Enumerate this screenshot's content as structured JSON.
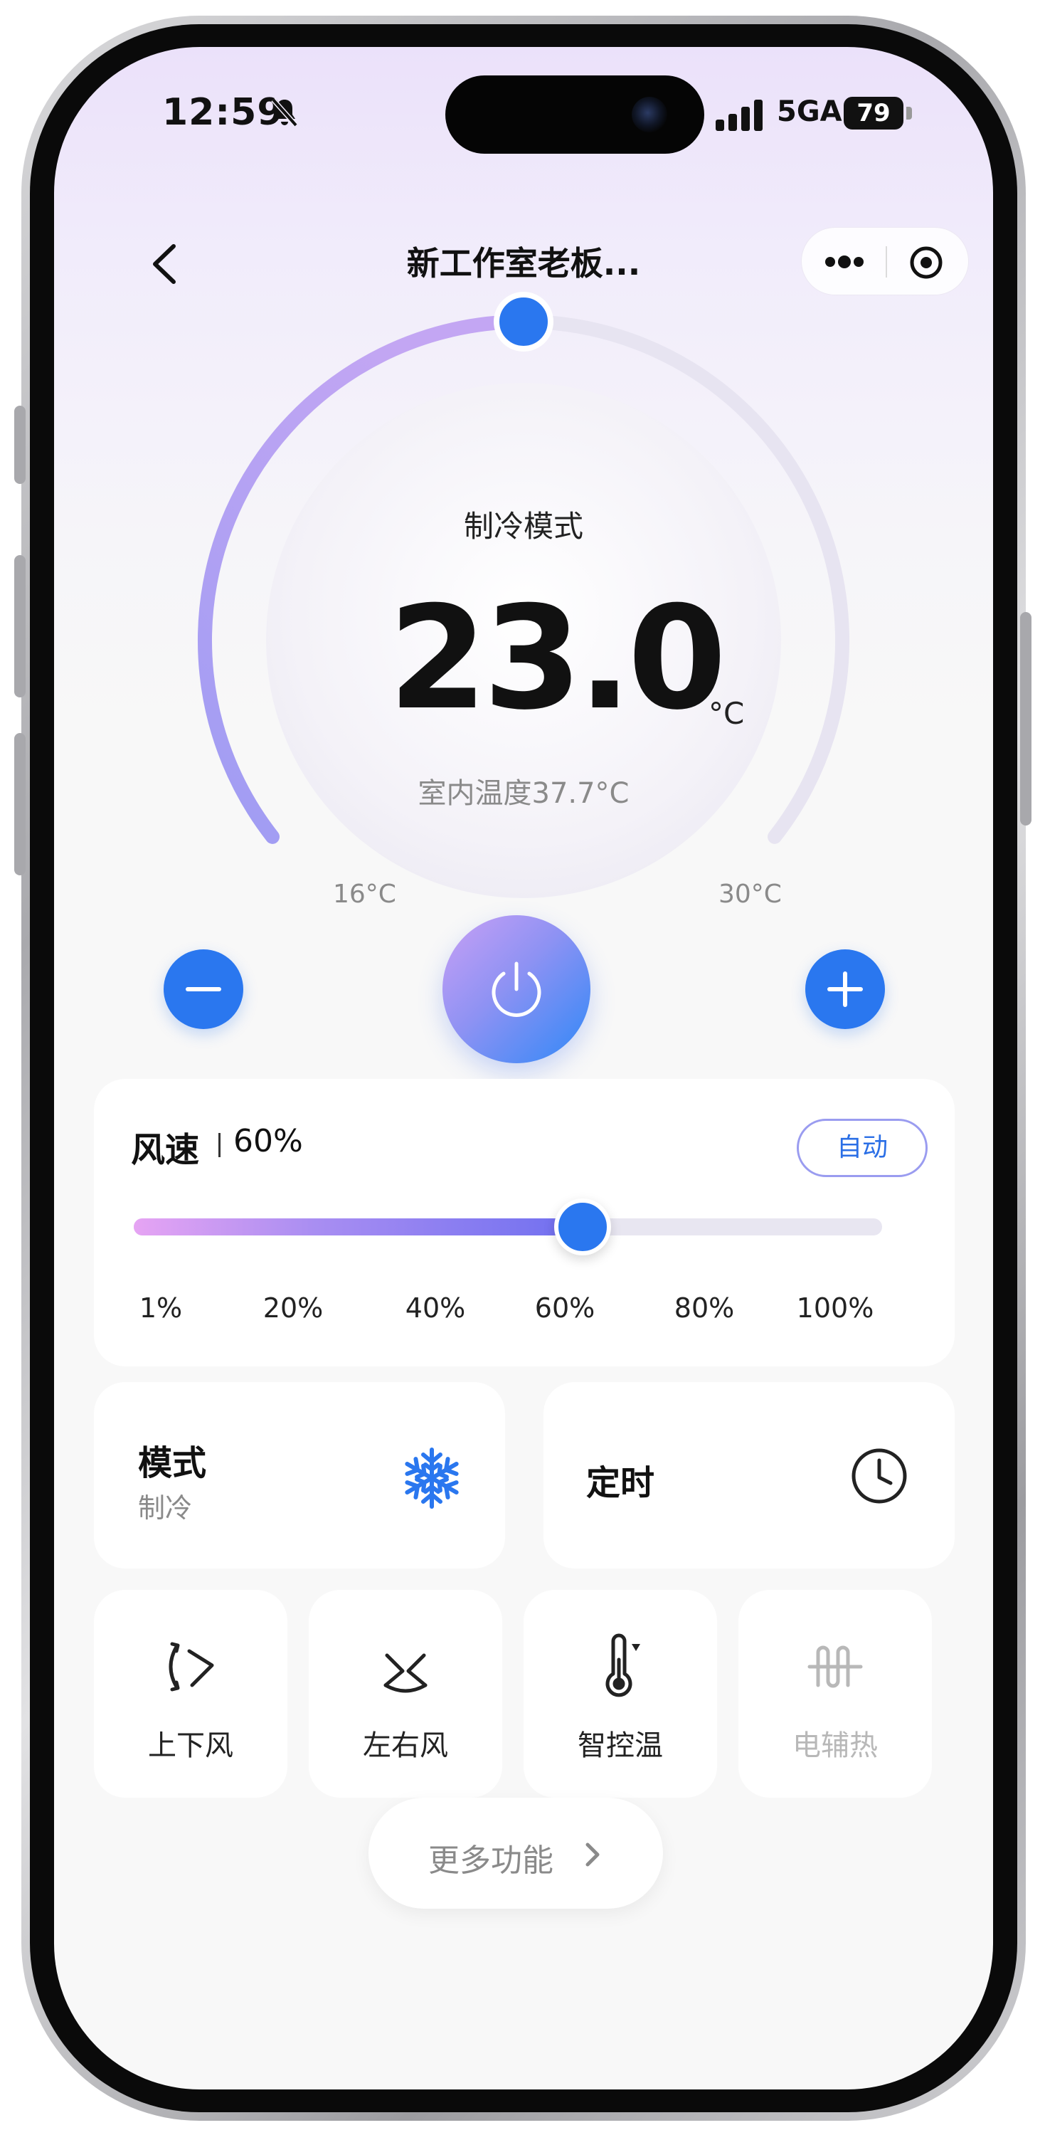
{
  "status_bar": {
    "time": "12:59",
    "network": "5GA",
    "battery": "79"
  },
  "nav": {
    "title": "新工作室老板..."
  },
  "thermostat": {
    "mode_label": "制冷模式",
    "set_temperature": "23.0",
    "unit": "°C",
    "indoor": "室内温度37.7°C",
    "min_label": "16°C",
    "max_label": "30°C",
    "min": 16,
    "max": 30,
    "value": 23
  },
  "wind": {
    "title": "风速",
    "value_label": "60%",
    "auto_label": "自动",
    "level": 0.6,
    "ticks": [
      "1%",
      "20%",
      "40%",
      "60%",
      "80%",
      "100%"
    ]
  },
  "mode_card": {
    "title": "模式",
    "value": "制冷"
  },
  "timer_card": {
    "title": "定时"
  },
  "functions": [
    {
      "label": "上下风",
      "icon": "swing-vertical-icon",
      "enabled": true
    },
    {
      "label": "左右风",
      "icon": "swing-horizontal-icon",
      "enabled": true
    },
    {
      "label": "智控温",
      "icon": "thermometer-icon",
      "enabled": true
    },
    {
      "label": "电辅热",
      "icon": "heater-icon",
      "enabled": false
    }
  ],
  "more_button": {
    "label": "更多功能"
  },
  "colors": {
    "accent": "#2a77ef",
    "arc_start": "#c3a6f3",
    "arc_end": "#9f9cf3",
    "muted_text": "#8a8a8a",
    "disabled_text": "#b8b8b8"
  }
}
